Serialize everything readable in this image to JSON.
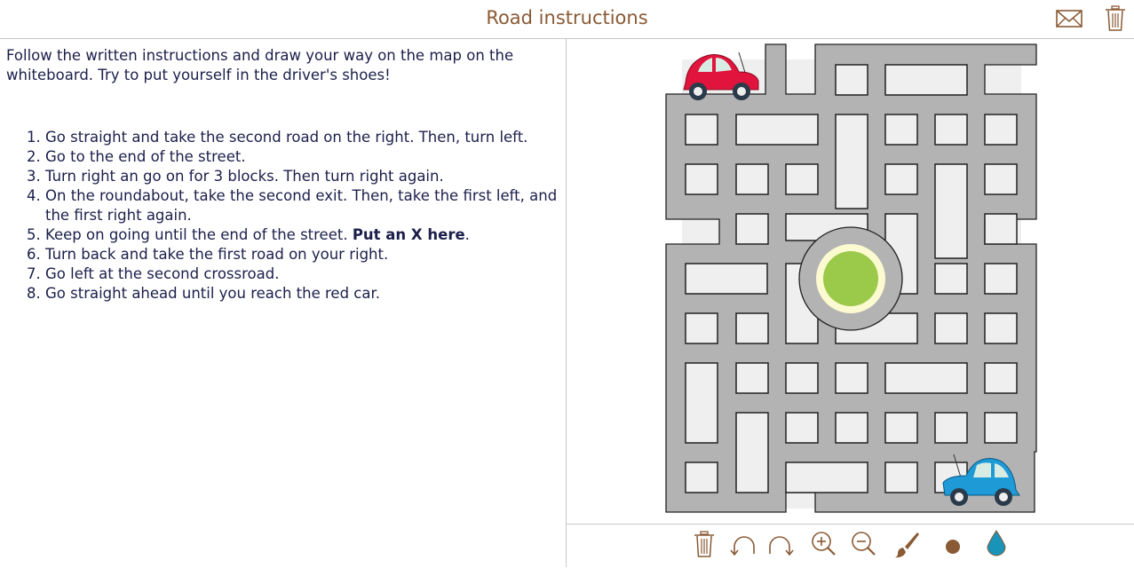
{
  "header": {
    "title": "Road instructions",
    "icons": [
      {
        "name": "mail-icon",
        "label": "Send"
      },
      {
        "name": "trash-icon",
        "label": "Delete"
      }
    ]
  },
  "instructions": {
    "intro": "Follow the written instructions and draw your way on the map on the whiteboard. Try to put yourself in the driver's shoes!",
    "steps": [
      {
        "text": "Go straight and take the second road on the right. Then, turn left.",
        "bold": ""
      },
      {
        "text": "Go to the end of the street.",
        "bold": ""
      },
      {
        "text": "Turn right an go on for 3 blocks. Then turn right again.",
        "bold": ""
      },
      {
        "text": "On the roundabout, take the second exit. Then, take the first left, and the first right again.",
        "bold": ""
      },
      {
        "text": "Keep on going until the end of the street. ",
        "bold": "Put an X here",
        "after": "."
      },
      {
        "text": "Turn back and take the first road on your right.",
        "bold": ""
      },
      {
        "text": "Go left at the second crossroad.",
        "bold": ""
      },
      {
        "text": "Go straight ahead until you reach the red car.",
        "bold": ""
      }
    ]
  },
  "whiteboard": {
    "map_image": "road-map-with-roundabout",
    "cars": [
      {
        "name": "red-car",
        "color": "#e0143c"
      },
      {
        "name": "blue-car",
        "color": "#1e9ad6"
      }
    ],
    "roundabout_color": "#9bc94a"
  },
  "toolbar": {
    "tools": [
      {
        "name": "clear-icon",
        "label": "Clear"
      },
      {
        "name": "undo-icon",
        "label": "Undo"
      },
      {
        "name": "redo-icon",
        "label": "Redo"
      },
      {
        "name": "zoom-in-icon",
        "label": "Zoom in"
      },
      {
        "name": "zoom-out-icon",
        "label": "Zoom out"
      },
      {
        "name": "brush-icon",
        "label": "Brush"
      },
      {
        "name": "brush-size-icon",
        "label": "Brush size"
      },
      {
        "name": "color-drop-icon",
        "label": "Color"
      }
    ],
    "active_color": "#1a93b8",
    "icon_color": "#8a5a35"
  }
}
